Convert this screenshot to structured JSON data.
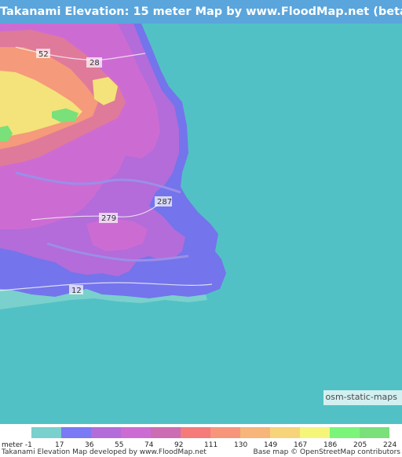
{
  "title": "Takanami Elevation: 15 meter Map by www.FloodMap.net (beta)",
  "map": {
    "road_labels": [
      "52",
      "28",
      "287",
      "279",
      "12"
    ],
    "attribution": "osm-static-maps",
    "sea_color": "#52c1c5"
  },
  "legend": {
    "unit_label": "meter",
    "ticks": [
      "-1",
      "17",
      "36",
      "55",
      "74",
      "92",
      "111",
      "130",
      "149",
      "167",
      "186",
      "205",
      "224"
    ],
    "colors": [
      "#7ad0cc",
      "#7a7af5",
      "#b36cd9",
      "#cc6cd3",
      "#cc6cb3",
      "#f57a7a",
      "#f7957a",
      "#f7b57a",
      "#f7d47a",
      "#f5f57a",
      "#7af57a",
      "#7ae07a"
    ]
  },
  "footer": {
    "left": "Takanami Elevation Map developed by www.FloodMap.net",
    "right": "Base map © OpenStreetMap contributors"
  }
}
